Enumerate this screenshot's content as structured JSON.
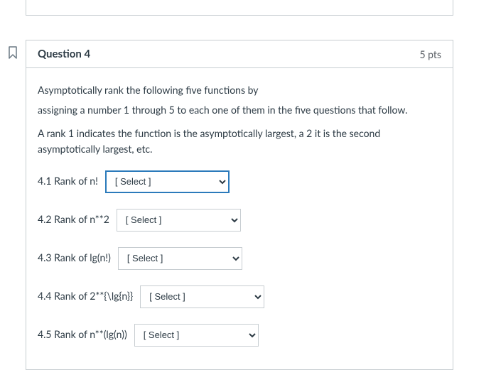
{
  "question": {
    "title": "Question 4",
    "points": "5 pts",
    "prompt_line1": "Asymptotically rank the following five functions by",
    "prompt_line2": "assigning a number 1 through 5 to each one of them in the five questions that follow.",
    "prompt_line3": "A rank 1 indicates the function is the  asymptotically largest,  a 2  it is the second asymptotically largest, etc.",
    "select_placeholder": "[ Select ]",
    "items": [
      {
        "label": "4.1  Rank of  n!"
      },
      {
        "label": "4.2  Rank of n**2"
      },
      {
        "label": "4.3  Rank of lg(n!)"
      },
      {
        "label": "4.4  Rank of 2**{\\lg{n}}"
      },
      {
        "label": "4.5  Rank of n**(lg(n))"
      }
    ]
  }
}
